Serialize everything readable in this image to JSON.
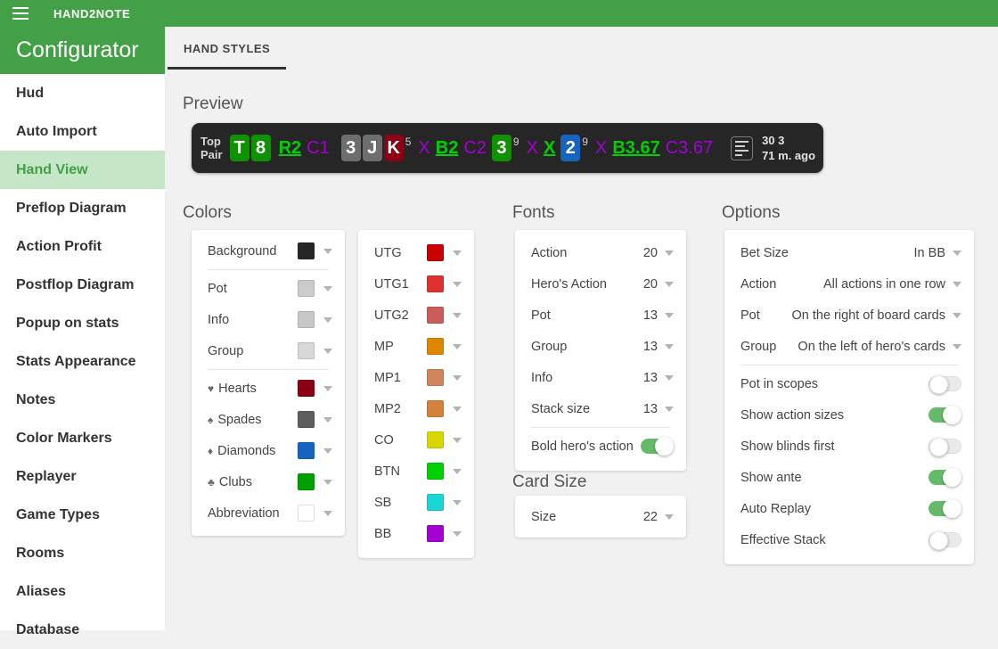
{
  "topbar": {
    "title": "HAND2NOTE",
    "menu_icon": "hamburger-icon"
  },
  "sidebar": {
    "header": "Configurator",
    "items": [
      {
        "label": "Hud",
        "active": false
      },
      {
        "label": "Auto Import",
        "active": false
      },
      {
        "label": "Hand View",
        "active": true
      },
      {
        "label": "Preflop Diagram",
        "active": false
      },
      {
        "label": "Action Profit",
        "active": false
      },
      {
        "label": "Postflop Diagram",
        "active": false
      },
      {
        "label": "Popup on stats",
        "active": false
      },
      {
        "label": "Stats Appearance",
        "active": false
      },
      {
        "label": "Notes",
        "active": false
      },
      {
        "label": "Color Markers",
        "active": false
      },
      {
        "label": "Replayer",
        "active": false
      },
      {
        "label": "Game Types",
        "active": false
      },
      {
        "label": "Rooms",
        "active": false
      },
      {
        "label": "Aliases",
        "active": false
      },
      {
        "label": "Database",
        "active": false
      }
    ]
  },
  "tabs": [
    {
      "label": "HAND STYLES",
      "active": true
    }
  ],
  "preview": {
    "title": "Preview",
    "group_line1": "Top",
    "group_line2": "Pair",
    "hero_cards": [
      {
        "rank": "T",
        "bg": "#0f9100"
      },
      {
        "rank": "8",
        "bg": "#0f9100"
      }
    ],
    "preflop_actions": [
      {
        "text": "R2",
        "color": "#00d000",
        "hero": true
      },
      {
        "text": "C1",
        "color": "#a400d4",
        "hero": false
      }
    ],
    "board_cards": [
      {
        "rank": "3",
        "bg": "#6e6e6e"
      },
      {
        "rank": "J",
        "bg": "#6e6e6e"
      },
      {
        "rank": "K",
        "bg": "#8b0014"
      }
    ],
    "flop_pot": "5",
    "flop_actions": [
      {
        "text": "X",
        "color": "#a400d4",
        "hero": false
      },
      {
        "text": "B2",
        "color": "#00d000",
        "hero": true
      },
      {
        "text": "C2",
        "color": "#a400d4",
        "hero": false
      }
    ],
    "turn_card": {
      "rank": "3",
      "bg": "#0f9100"
    },
    "turn_pot": "9",
    "turn_actions": [
      {
        "text": "X",
        "color": "#a400d4",
        "hero": false
      },
      {
        "text": "X",
        "color": "#00d000",
        "hero": true
      }
    ],
    "river_card": {
      "rank": "2",
      "bg": "#1565c0"
    },
    "river_pot": "9",
    "river_actions": [
      {
        "text": "X",
        "color": "#a400d4",
        "hero": false
      },
      {
        "text": "B3.67",
        "color": "#00d000",
        "hero": true
      },
      {
        "text": "C3.67",
        "color": "#a400d4",
        "hero": false
      }
    ],
    "note_icon": "note-lines-icon",
    "info_line1": "30 3",
    "info_line2": "71 m. ago"
  },
  "colors": {
    "title": "Colors",
    "rows": [
      {
        "label": "Background",
        "color": "#262626",
        "suit": ""
      },
      {
        "label": "Pot",
        "color": "#cccccc",
        "suit": ""
      },
      {
        "label": "Info",
        "color": "#c8c8c8",
        "suit": ""
      },
      {
        "label": "Group",
        "color": "#d8d8d8",
        "suit": ""
      },
      {
        "label": "Hearts",
        "color": "#8b0014",
        "suit": "♥"
      },
      {
        "label": "Spades",
        "color": "#5e5e5e",
        "suit": "♠"
      },
      {
        "label": "Diamonds",
        "color": "#1565c0",
        "suit": "♦"
      },
      {
        "label": "Clubs",
        "color": "#00a000",
        "suit": "♣"
      },
      {
        "label": "Abbreviation",
        "color": "#ffffff",
        "suit": ""
      }
    ]
  },
  "positions": {
    "rows": [
      {
        "label": "UTG",
        "color": "#cc0000"
      },
      {
        "label": "UTG1",
        "color": "#e03131"
      },
      {
        "label": "UTG2",
        "color": "#cc5c5c"
      },
      {
        "label": "MP",
        "color": "#e08700"
      },
      {
        "label": "MP1",
        "color": "#d2855c"
      },
      {
        "label": "MP2",
        "color": "#d4813a"
      },
      {
        "label": "CO",
        "color": "#d8d800"
      },
      {
        "label": "BTN",
        "color": "#00d000"
      },
      {
        "label": "SB",
        "color": "#19d7d7"
      },
      {
        "label": "BB",
        "color": "#a400d4"
      }
    ]
  },
  "fonts": {
    "title": "Fonts",
    "rows": [
      {
        "label": "Action",
        "value": "20"
      },
      {
        "label": "Hero's Action",
        "value": "20"
      },
      {
        "label": "Pot",
        "value": "13"
      },
      {
        "label": "Group",
        "value": "13"
      },
      {
        "label": "Info",
        "value": "13"
      },
      {
        "label": "Stack size",
        "value": "13"
      }
    ],
    "bold_hero_label": "Bold hero's action",
    "bold_hero_on": true
  },
  "card_size": {
    "title": "Card Size",
    "label": "Size",
    "value": "22"
  },
  "options": {
    "title": "Options",
    "selects": [
      {
        "label": "Bet Size",
        "value": "In BB"
      },
      {
        "label": "Action",
        "value": "All actions in one row"
      },
      {
        "label": "Pot",
        "value": "On the right of board cards"
      },
      {
        "label": "Group",
        "value": "On the left of hero's cards"
      }
    ],
    "toggles": [
      {
        "label": "Pot in scopes",
        "on": false
      },
      {
        "label": "Show action sizes",
        "on": true
      },
      {
        "label": "Show blinds first",
        "on": false
      },
      {
        "label": "Show ante",
        "on": true
      },
      {
        "label": "Auto Replay",
        "on": true
      },
      {
        "label": "Effective Stack",
        "on": false
      }
    ]
  },
  "theme": {
    "brand_green": "#43a047",
    "active_bg": "#c6e6c8",
    "toggle_on": "#66bb6a",
    "page_bg": "#f1f1f1"
  }
}
